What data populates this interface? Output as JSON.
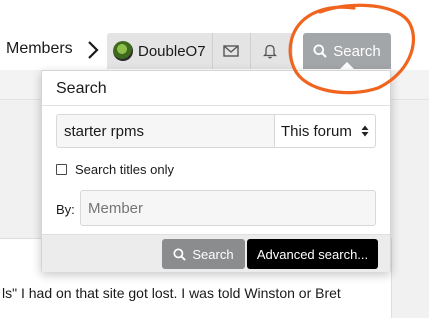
{
  "nav": {
    "members_label": "Members",
    "username": "DoubleO7",
    "search_label": "Search"
  },
  "content": {
    "text": "ls\" I had on that site got lost. I was told Winston or Bret"
  },
  "search_dropdown": {
    "title": "Search",
    "keywords_value": "starter rpms",
    "scope_selected": "This forum",
    "titles_only_label": "Search titles only",
    "titles_only_checked": false,
    "by_label": "By:",
    "member_placeholder": "Member",
    "search_button_label": "Search",
    "advanced_button_label": "Advanced search..."
  },
  "colors": {
    "annotation_circle": "#f0641e",
    "search_tab": "#a3a6a9",
    "search_button": "#8a8c8e",
    "advanced_button": "#000000"
  },
  "icons": {
    "chevron": "chevron-right-icon",
    "mail": "envelope-icon",
    "bell": "bell-icon",
    "search": "magnifier-icon",
    "select": "up-down-arrows-icon"
  }
}
